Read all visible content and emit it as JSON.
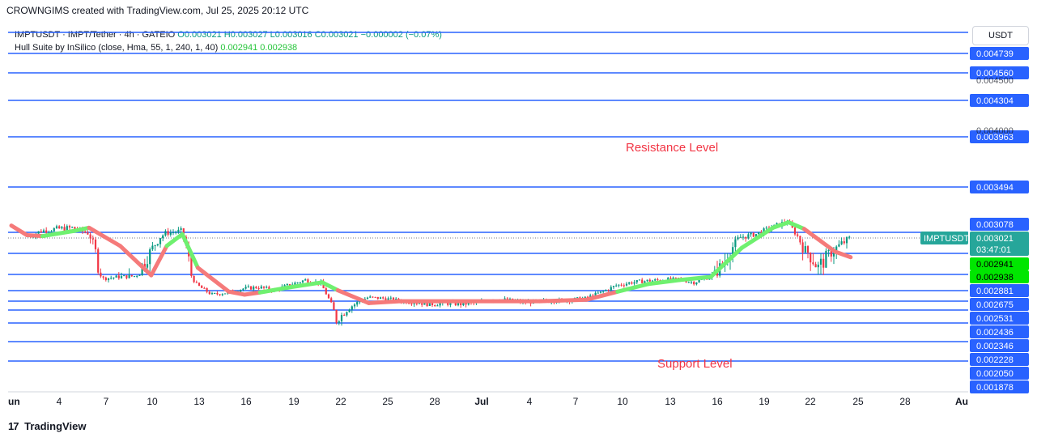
{
  "header": {
    "title": "CROWNGIMS created with TradingView.com, Jul 25, 2025 20:12 UTC"
  },
  "legend": {
    "symbol": "IMPTUSDT · IMPT/Tether · 4h · GATEIO",
    "ohlc": "O0.003021 H0.003027 L0.003016 C0.003021 −0.000002 (−0.07%)",
    "indicator_name": "Hull Suite by InSilico (close, Hma, 55, 1, 240, 1, 40)",
    "indicator_values": "0.002941  0.002938"
  },
  "currency": "USDT",
  "footer": {
    "brand": "TradingView",
    "icon": "tradingview-logo-icon"
  },
  "colors": {
    "level_line": "#2962ff",
    "bull": "#089981",
    "bear": "#f23645",
    "hull_up": "#6ff06f",
    "hull_down": "#f57a7a",
    "level_label": "#2962ff",
    "annotation": "#f23645",
    "last_price": "#26a69a",
    "hull_label": "#00e600"
  },
  "chart_data": {
    "type": "candlestick",
    "symbol_label": "IMPTUSDT",
    "last_price": "0.003021",
    "countdown": "03:47:01",
    "hull_values": [
      "0.002941",
      "0.002938"
    ],
    "levels": [
      "0.004739",
      "0.004560",
      "0.004304",
      "0.003963",
      "0.003494",
      "0.003078",
      "0.002881",
      "0.002675",
      "0.002531",
      "0.002436",
      "0.002346",
      "0.002228",
      "0.002050",
      "0.001878"
    ],
    "hidden_levels": [
      "0.004500",
      "0.004000"
    ],
    "annotations": [
      "Resistance Level",
      "Support Level"
    ],
    "x_ticks": [
      "un",
      "4",
      "7",
      "10",
      "13",
      "16",
      "19",
      "22",
      "25",
      "28",
      "Jul",
      "4",
      "7",
      "10",
      "13",
      "16",
      "19",
      "22",
      "25",
      "28",
      "Au"
    ],
    "price_path": [
      [
        "Jun 2",
        0.00303
      ],
      [
        "Jun 3",
        0.00309
      ],
      [
        "Jun 4",
        0.00311
      ],
      [
        "Jun 5",
        0.00312
      ],
      [
        "Jun 6",
        0.00307
      ],
      [
        "Jun 7",
        0.00283
      ],
      [
        "Jun 8",
        0.00285
      ],
      [
        "Jun 9",
        0.00286
      ],
      [
        "Jun 10",
        0.00295
      ],
      [
        "Jun 11",
        0.00307
      ],
      [
        "Jun 12",
        0.00309
      ],
      [
        "Jun 13",
        0.00275
      ],
      [
        "Jun 14",
        0.00262
      ],
      [
        "Jun 15",
        0.00265
      ],
      [
        "Jun 16",
        0.0027
      ],
      [
        "Jun 17",
        0.00272
      ],
      [
        "Jun 18",
        0.00268
      ],
      [
        "Jun 19",
        0.00275
      ],
      [
        "Jun 20",
        0.00281
      ],
      [
        "Jun 21",
        0.00277
      ],
      [
        "Jun 22",
        0.00236
      ],
      [
        "Jun 23",
        0.00248
      ],
      [
        "Jun 24",
        0.00258
      ],
      [
        "Jun 25",
        0.00257
      ],
      [
        "Jun 26",
        0.00254
      ],
      [
        "Jun 27",
        0.00252
      ],
      [
        "Jun 28",
        0.0025
      ],
      [
        "Jun 29",
        0.00251
      ],
      [
        "Jun 30",
        0.0025
      ],
      [
        "Jul 1",
        0.00251
      ],
      [
        "Jul 2",
        0.00256
      ],
      [
        "Jul 3",
        0.00255
      ],
      [
        "Jul 4",
        0.00252
      ],
      [
        "Jul 5",
        0.00253
      ],
      [
        "Jul 6",
        0.00254
      ],
      [
        "Jul 7",
        0.00255
      ],
      [
        "Jul 8",
        0.00257
      ],
      [
        "Jul 9",
        0.00265
      ],
      [
        "Jul 10",
        0.00274
      ],
      [
        "Jul 11",
        0.00278
      ],
      [
        "Jul 12",
        0.0028
      ],
      [
        "Jul 13",
        0.00281
      ],
      [
        "Jul 14",
        0.00282
      ],
      [
        "Jul 15",
        0.00278
      ],
      [
        "Jul 16",
        0.00285
      ],
      [
        "Jul 17",
        0.00292
      ],
      [
        "Jul 18",
        0.00303
      ],
      [
        "Jul 19",
        0.00306
      ],
      [
        "Jul 20",
        0.00312
      ],
      [
        "Jul 21",
        0.00318
      ],
      [
        "Jul 22",
        0.00297
      ],
      [
        "Jul 23",
        0.0029
      ],
      [
        "Jul 24",
        0.00296
      ],
      [
        "Jul 25",
        0.00302
      ]
    ],
    "hull_path": [
      [
        "Jun 1",
        0.00314,
        "down"
      ],
      [
        "Jun 2",
        0.00305,
        "down"
      ],
      [
        "Jun 3",
        0.00304,
        "up"
      ],
      [
        "Jun 5",
        0.00309,
        "up"
      ],
      [
        "Jun 6",
        0.00312,
        "down"
      ],
      [
        "Jun 8",
        0.00298,
        "down"
      ],
      [
        "Jun 10",
        0.00287,
        "down"
      ],
      [
        "Jun 11",
        0.00298,
        "up"
      ],
      [
        "Jun 12",
        0.00306,
        "up"
      ],
      [
        "Jun 13",
        0.0029,
        "down"
      ],
      [
        "Jun 15",
        0.00266,
        "down"
      ],
      [
        "Jun 16",
        0.00262,
        "down"
      ],
      [
        "Jun 17",
        0.00265,
        "up"
      ],
      [
        "Jun 19",
        0.00272,
        "up"
      ],
      [
        "Jun 21",
        0.00278,
        "up"
      ],
      [
        "Jun 22",
        0.00268,
        "down"
      ],
      [
        "Jun 24",
        0.00251,
        "down"
      ],
      [
        "Jun 26",
        0.00253,
        "down"
      ],
      [
        "Jul 2",
        0.00253,
        "down"
      ],
      [
        "Jul 5",
        0.00253,
        "down"
      ],
      [
        "Jul 8",
        0.00255,
        "down"
      ],
      [
        "Jul 10",
        0.00266,
        "up"
      ],
      [
        "Jul 12",
        0.00276,
        "up"
      ],
      [
        "Jul 14",
        0.00281,
        "up"
      ],
      [
        "Jul 16",
        0.00285,
        "up"
      ],
      [
        "Jul 18",
        0.00297,
        "up"
      ],
      [
        "Jul 20",
        0.00312,
        "up"
      ],
      [
        "Jul 21",
        0.00317,
        "up"
      ],
      [
        "Jul 22",
        0.00311,
        "down"
      ],
      [
        "Jul 24",
        0.00295,
        "down"
      ],
      [
        "Jul 25",
        0.00293,
        "down"
      ]
    ]
  }
}
